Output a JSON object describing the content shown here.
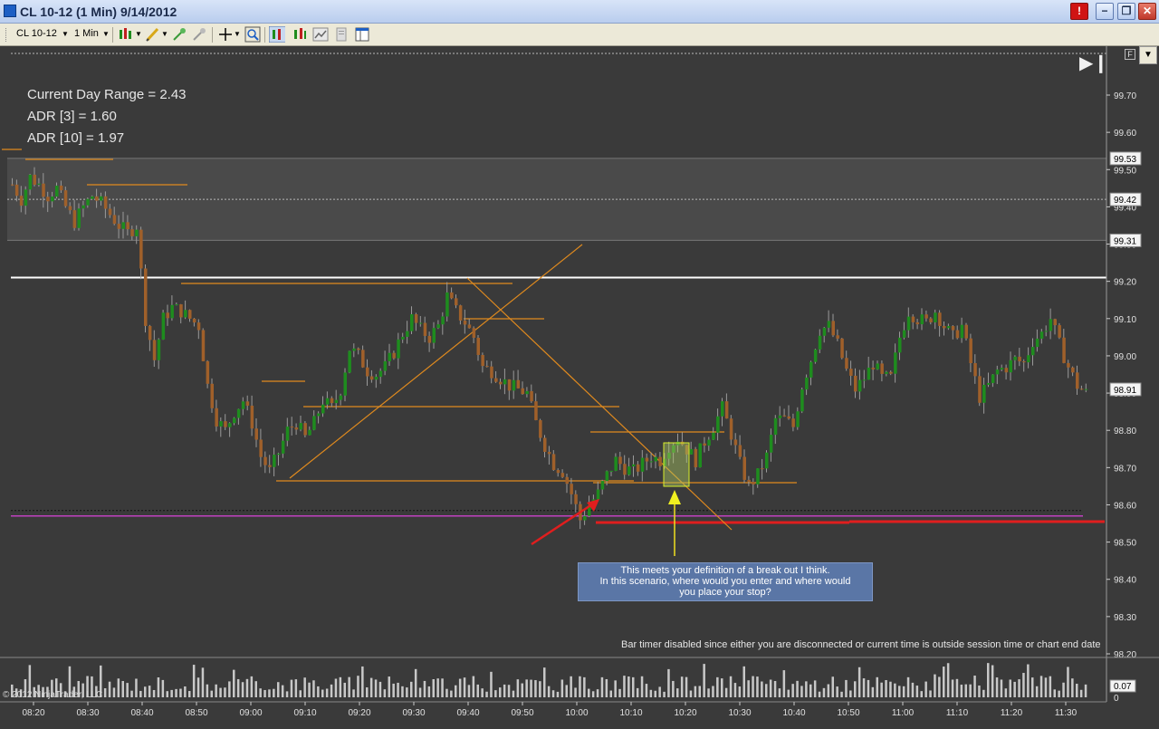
{
  "window": {
    "title": "CL 10-12 (1 Min)  9/14/2012",
    "alert_label": "!",
    "minimize": "−",
    "maximize": "❐",
    "close": "✕"
  },
  "toolbar": {
    "instrument": "CL 10-12",
    "interval": "1 Min",
    "icons": [
      "chart-style-icon",
      "drawing-tools-icon",
      "indicator-icon",
      "strategy-icon",
      "crosshair-icon",
      "zoom-icon",
      "data-box-icon",
      "chart-trader-icon",
      "properties-icon",
      "print-icon",
      "layout-icon"
    ]
  },
  "stats": {
    "current_day_range": "Current Day Range = 2.43",
    "adr3": "ADR [3] = 1.60",
    "adr10": "ADR [10] = 1.97"
  },
  "annotation": {
    "line1": "This meets your definition of a break out I think.",
    "line2": "In this scenario, where would you enter and where would",
    "line3": "you place your stop?"
  },
  "bar_timer": "Bar timer disabled since either you are disconnected or current time is outside session time or chart end date",
  "copyright": "© 2012 NinjaTrader, LLC",
  "f_button": "F",
  "colors": {
    "background": "#3a3a3a",
    "up_candle": "#1e8c1e",
    "down_candle": "#a0602a",
    "orange_line": "#e08a1e",
    "red_line": "#e01e1e",
    "magenta_line": "#c040c0",
    "white_line": "#ffffff"
  },
  "chart_data": {
    "type": "candlestick",
    "y_ticks": [
      "99.70",
      "99.60",
      "99.50",
      "99.40",
      "99.30",
      "99.20",
      "99.10",
      "99.00",
      "98.90",
      "98.80",
      "98.70",
      "98.60",
      "98.50",
      "98.40",
      "98.30",
      "98.20"
    ],
    "price_labels": [
      "99.53",
      "99.42",
      "99.31",
      "98.91"
    ],
    "x_ticks": [
      "08:20",
      "08:30",
      "08:40",
      "08:50",
      "09:00",
      "09:10",
      "09:20",
      "09:30",
      "09:40",
      "09:50",
      "10:00",
      "10:10",
      "10:20",
      "10:30",
      "10:40",
      "10:50",
      "11:00",
      "11:10",
      "11:20",
      "11:30"
    ],
    "ylim": [
      98.2,
      99.78
    ],
    "volume_label": "0.07",
    "volume_zero": "0",
    "key_levels": {
      "white_resistance": 99.21,
      "magenta_support": 98.57,
      "red_support": 98.555,
      "shaded_zone_top": 99.53,
      "shaded_zone_mid": 99.42,
      "shaded_zone_bottom": 99.31
    },
    "close_path": [
      [
        0,
        99.46
      ],
      [
        2,
        99.42
      ],
      [
        4,
        99.48
      ],
      [
        6,
        99.46
      ],
      [
        8,
        99.43
      ],
      [
        10,
        99.45
      ],
      [
        12,
        99.4
      ],
      [
        14,
        99.36
      ],
      [
        16,
        99.4
      ],
      [
        18,
        99.43
      ],
      [
        20,
        99.41
      ],
      [
        22,
        99.38
      ],
      [
        24,
        99.35
      ],
      [
        26,
        99.33
      ],
      [
        28,
        99.35
      ],
      [
        30,
        99.1
      ],
      [
        32,
        98.99
      ],
      [
        34,
        99.1
      ],
      [
        36,
        99.13
      ],
      [
        38,
        99.12
      ],
      [
        40,
        99.1
      ],
      [
        42,
        99.08
      ],
      [
        44,
        98.92
      ],
      [
        46,
        98.83
      ],
      [
        48,
        98.8
      ],
      [
        50,
        98.85
      ],
      [
        52,
        98.88
      ],
      [
        54,
        98.82
      ],
      [
        56,
        98.73
      ],
      [
        58,
        98.69
      ],
      [
        60,
        98.74
      ],
      [
        62,
        98.8
      ],
      [
        64,
        98.82
      ],
      [
        66,
        98.78
      ],
      [
        68,
        98.82
      ],
      [
        70,
        98.88
      ],
      [
        72,
        98.86
      ],
      [
        74,
        98.91
      ],
      [
        76,
        99.02
      ],
      [
        78,
        99.0
      ],
      [
        80,
        98.96
      ],
      [
        82,
        98.95
      ],
      [
        84,
        98.97
      ],
      [
        86,
        99.01
      ],
      [
        88,
        99.06
      ],
      [
        90,
        99.1
      ],
      [
        92,
        99.07
      ],
      [
        94,
        99.05
      ],
      [
        96,
        99.08
      ],
      [
        98,
        99.16
      ],
      [
        100,
        99.12
      ],
      [
        102,
        99.09
      ],
      [
        104,
        99.05
      ],
      [
        106,
        98.97
      ],
      [
        108,
        98.96
      ],
      [
        110,
        98.94
      ],
      [
        112,
        98.92
      ],
      [
        114,
        98.91
      ],
      [
        116,
        98.9
      ],
      [
        118,
        98.82
      ],
      [
        120,
        98.76
      ],
      [
        122,
        98.71
      ],
      [
        124,
        98.69
      ],
      [
        126,
        98.63
      ],
      [
        128,
        98.56
      ],
      [
        130,
        98.6
      ],
      [
        132,
        98.63
      ],
      [
        134,
        98.68
      ],
      [
        136,
        98.72
      ],
      [
        138,
        98.7
      ],
      [
        140,
        98.69
      ],
      [
        142,
        98.71
      ],
      [
        144,
        98.73
      ],
      [
        146,
        98.72
      ],
      [
        148,
        98.76
      ],
      [
        150,
        98.78
      ],
      [
        152,
        98.75
      ],
      [
        154,
        98.72
      ],
      [
        156,
        98.77
      ],
      [
        158,
        98.81
      ],
      [
        160,
        98.86
      ],
      [
        162,
        98.79
      ],
      [
        164,
        98.71
      ],
      [
        166,
        98.65
      ],
      [
        168,
        98.68
      ],
      [
        170,
        98.73
      ],
      [
        172,
        98.83
      ],
      [
        174,
        98.83
      ],
      [
        176,
        98.81
      ],
      [
        178,
        98.92
      ],
      [
        180,
        98.99
      ],
      [
        182,
        99.07
      ],
      [
        184,
        99.08
      ],
      [
        186,
        99.03
      ],
      [
        188,
        98.96
      ],
      [
        190,
        98.91
      ],
      [
        192,
        98.94
      ],
      [
        194,
        98.98
      ],
      [
        196,
        98.94
      ],
      [
        198,
        98.94
      ],
      [
        200,
        99.05
      ],
      [
        202,
        99.12
      ],
      [
        204,
        99.1
      ],
      [
        206,
        99.09
      ],
      [
        208,
        99.12
      ],
      [
        210,
        99.08
      ],
      [
        212,
        99.05
      ],
      [
        214,
        99.08
      ],
      [
        216,
        98.98
      ],
      [
        218,
        98.89
      ],
      [
        220,
        98.92
      ],
      [
        222,
        98.96
      ],
      [
        224,
        98.97
      ],
      [
        226,
        98.99
      ],
      [
        228,
        98.98
      ],
      [
        230,
        99.04
      ],
      [
        232,
        99.06
      ],
      [
        234,
        99.1
      ],
      [
        236,
        99.03
      ],
      [
        238,
        98.97
      ],
      [
        240,
        98.92
      ],
      [
        242,
        98.9
      ]
    ]
  }
}
